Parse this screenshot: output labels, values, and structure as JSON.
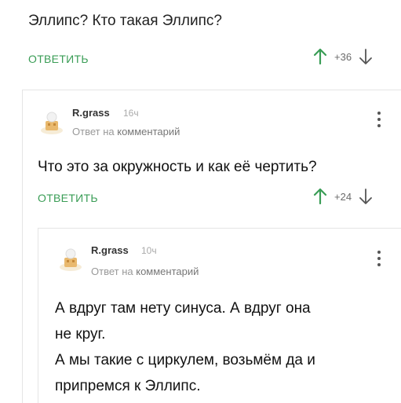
{
  "root_comment": {
    "text": "Эллипс? Кто такая Эллипс?",
    "reply_label": "ОТВЕТИТЬ",
    "score": "+36"
  },
  "reply1": {
    "username": "R.grass",
    "time": "16ч",
    "meta_prefix": "Ответ на",
    "meta_link": "комментарий",
    "text": "Что это за окружность и как её чертить?",
    "reply_label": "ОТВЕТИТЬ",
    "score": "+24"
  },
  "reply2": {
    "username": "R.grass",
    "time": "10ч",
    "meta_prefix": "Ответ на",
    "meta_link": "комментарий",
    "lines": [
      "А вдруг там нету синуса. А вдруг она",
      "не круг.",
      "А мы такие с циркулем, возьмём да и",
      "припремся к Эллипс."
    ]
  },
  "colors": {
    "accent": "#3a9d56",
    "muted": "#999999"
  },
  "icons": [
    "up-arrow-icon",
    "down-arrow-icon",
    "more-vertical-icon",
    "avatar-icon"
  ]
}
